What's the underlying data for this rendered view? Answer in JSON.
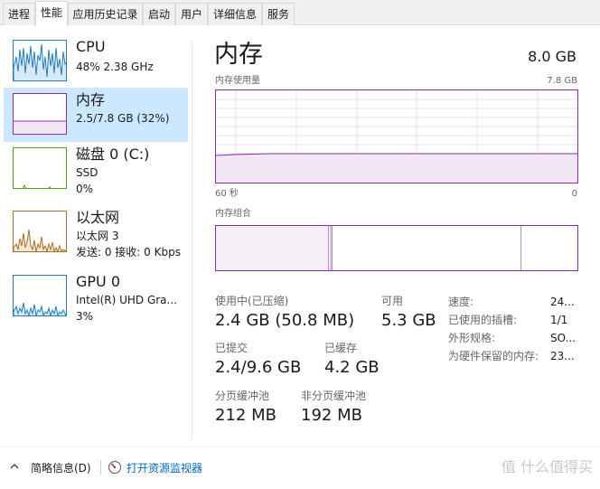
{
  "tabs": [
    "进程",
    "性能",
    "应用历史记录",
    "启动",
    "用户",
    "详细信息",
    "服务"
  ],
  "active_tab": 1,
  "sidebar": {
    "items": [
      {
        "title": "CPU",
        "line1": "48%  2.38 GHz",
        "line2": "",
        "line3": ""
      },
      {
        "title": "内存",
        "line1": "2.5/7.8 GB (32%)",
        "line2": "",
        "line3": ""
      },
      {
        "title": "磁盘 0 (C:)",
        "line1": "SSD",
        "line2": "0%",
        "line3": ""
      },
      {
        "title": "以太网",
        "line1": "以太网 3",
        "line2": "发送: 0  接收: 0 Kbps",
        "line3": ""
      },
      {
        "title": "GPU 0",
        "line1": "Intel(R) UHD Gra...",
        "line2": "3%",
        "line3": ""
      }
    ],
    "colors": {
      "cpu": "#1f7bbf",
      "memory": "#8b2fa0",
      "disk": "#4da60c",
      "ethernet": "#a76f1f",
      "gpu": "#1f7bbf"
    }
  },
  "main": {
    "title": "内存",
    "total": "8.0 GB",
    "usage_label": "内存使用量",
    "usage_max": "7.8 GB",
    "time_left": "60 秒",
    "time_right": "0",
    "composition_label": "内存组合",
    "stats": {
      "in_use_label": "使用中(已压缩)",
      "in_use_value": "2.4 GB (50.8 MB)",
      "available_label": "可用",
      "available_value": "5.3 GB",
      "committed_label": "已提交",
      "committed_value": "2.4/9.6 GB",
      "cached_label": "已缓存",
      "cached_value": "4.2 GB",
      "paged_label": "分页缓冲池",
      "paged_value": "212 MB",
      "nonpaged_label": "非分页缓冲池",
      "nonpaged_value": "192 MB"
    },
    "details": [
      {
        "label": "速度:",
        "value": "24..."
      },
      {
        "label": "已使用的插槽:",
        "value": "1/1"
      },
      {
        "label": "外形规格:",
        "value": "SO..."
      },
      {
        "label": "为硬件保留的内存:",
        "value": "23..."
      }
    ]
  },
  "footer": {
    "summary": "简略信息(D)",
    "open_monitor": "打开资源监视器"
  },
  "watermark": "值 什么值得买"
}
